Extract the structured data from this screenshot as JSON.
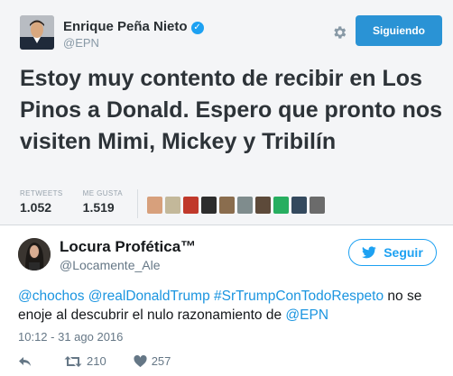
{
  "quoted_tweet": {
    "author_name": "Enrique Peña Nieto",
    "author_handle": "@EPN",
    "follow_label": "Siguiendo",
    "text": "Estoy muy contento de recibir en Los Pinos a Donald. Espero que pronto nos visiten Mimi, Mickey y Tribilín",
    "retweets_label": "RETWEETS",
    "retweets_value": "1.052",
    "likes_label": "ME GUSTA",
    "likes_value": "1.519",
    "liker_colors": [
      "#d7a07c",
      "#c3b89a",
      "#c0392b",
      "#2d2d2d",
      "#8a6d4e",
      "#7f8c8d",
      "#5d4a3a",
      "#27ae60",
      "#34495e",
      "#6b6b6b"
    ]
  },
  "tweet": {
    "author_name": "Locura Profética™",
    "author_handle": "@Locamente_Ale",
    "follow_label": "Seguir",
    "mentions": [
      "@chochos",
      "@realDonaldTrump"
    ],
    "hashtag": "#SrTrumpConTodoRespeto",
    "text_part": "no se enoje al descubrir el nulo razonamiento de",
    "final_mention": "@EPN",
    "timestamp": "10:12 - 31 ago 2016",
    "retweet_count": "210",
    "like_count": "257"
  },
  "colors": {
    "accent": "#1da1f2",
    "link": "#1b95e0",
    "muted": "#657786"
  },
  "icons": [
    "verified-icon",
    "gear-icon",
    "twitter-bird-icon",
    "reply-icon",
    "retweet-icon",
    "heart-icon"
  ]
}
